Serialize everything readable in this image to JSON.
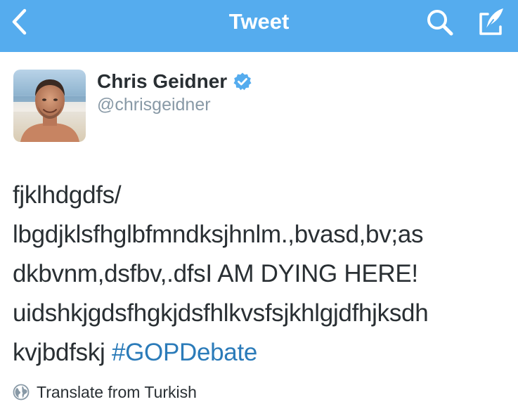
{
  "nav": {
    "title": "Tweet",
    "back_icon": "chevron-left-icon",
    "search_icon": "search-icon",
    "compose_icon": "compose-icon",
    "bar_color": "#55acee"
  },
  "author": {
    "name": "Chris Geidner",
    "handle": "@chrisgeidner",
    "verified": true,
    "verified_color": "#55acee"
  },
  "tweet": {
    "lines": [
      "fjklhdgdfs/",
      "lbgdjklsfhglbfmndksjhnlm.,bvasd,bv;as",
      "dkbvnm,dsfbv,.dfsI AM DYING HERE!",
      "uidshkjgdsfhgkjdsfhlkvsfsjkhlgjdfhjksdh",
      "kvjbdfskj "
    ],
    "hashtag": "#GOPDebate",
    "hashtag_color": "#2b7bb9"
  },
  "translate": {
    "label": "Translate from Turkish",
    "icon": "globe-icon"
  }
}
